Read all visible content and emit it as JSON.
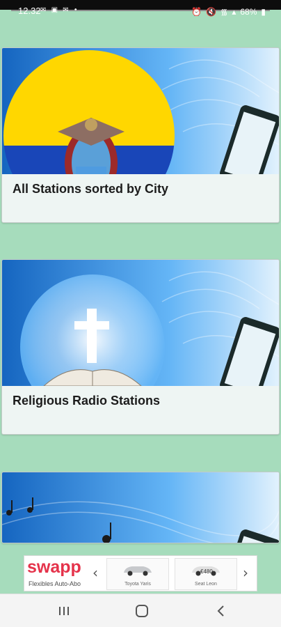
{
  "status_bar": {
    "time": "12.32",
    "notification_icons": [
      "gmail-icon",
      "image-icon",
      "mail-icon",
      "dot-icon"
    ],
    "battery": "68%",
    "system_icons": [
      "alarm-icon",
      "mute-icon",
      "wifi-icon",
      "signal-icon",
      "battery-icon"
    ]
  },
  "cards": [
    {
      "title": "All Stations sorted by City",
      "image": "ecuador-flag-emblem"
    },
    {
      "title": "Religious Radio Stations",
      "image": "cross-over-bible"
    },
    {
      "title": "",
      "image": "music-notes"
    }
  ],
  "ad": {
    "brand": "swapp",
    "tagline": "Flexibles Auto-Abo",
    "tiles": [
      {
        "caption": "Toyota Yaris",
        "price": ""
      },
      {
        "caption": "Seat Leon",
        "price": "€480"
      }
    ],
    "colors": {
      "brand": "#e5334b"
    }
  },
  "nav": {
    "buttons": [
      "recents-icon",
      "home-icon",
      "back-icon"
    ]
  },
  "colors": {
    "background": "#a6dcbc",
    "card": "#eef5f3",
    "banner_sky": "#1e88e5"
  }
}
